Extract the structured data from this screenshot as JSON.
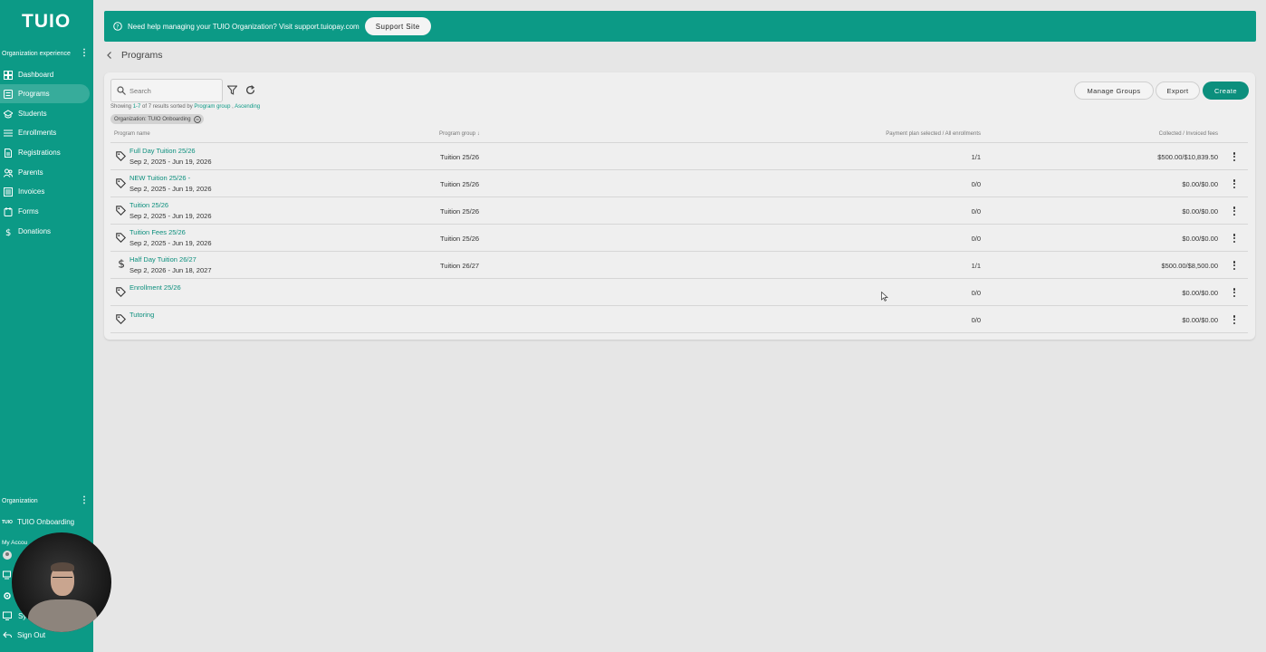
{
  "sidebar": {
    "logo": "TUIO",
    "section_experience": "Organization experience",
    "items": [
      {
        "label": "Dashboard",
        "icon": "dashboard-icon"
      },
      {
        "label": "Programs",
        "icon": "programs-icon",
        "active": true
      },
      {
        "label": "Students",
        "icon": "students-icon"
      },
      {
        "label": "Enrollments",
        "icon": "enrollments-icon"
      },
      {
        "label": "Registrations",
        "icon": "registrations-icon"
      },
      {
        "label": "Parents",
        "icon": "parents-icon"
      },
      {
        "label": "Invoices",
        "icon": "invoices-icon"
      },
      {
        "label": "Forms",
        "icon": "forms-icon"
      },
      {
        "label": "Donations",
        "icon": "dollar-icon"
      }
    ],
    "section_org": "Organization",
    "org_mini_logo": "TUIO",
    "org_name": "TUIO Onboarding",
    "section_account": "My Accou",
    "system_label": "Sy",
    "sign_out": "Sign Out"
  },
  "banner": {
    "text": "Need help managing your TUIO Organization? Visit support.tuiopay.com",
    "button": "Support Site"
  },
  "page": {
    "title": "Programs"
  },
  "toolbar": {
    "search_placeholder": "Search",
    "manage_groups": "Manage Groups",
    "export": "Export",
    "create": "Create"
  },
  "results": {
    "prefix": "Showing ",
    "range": "1-7",
    "middle": " of 7 results sorted by ",
    "sort_field": "Program group",
    "sep": " , ",
    "sort_dir": "Ascending"
  },
  "filter_chip": "Organization: TUIO Onboarding",
  "table": {
    "headers": {
      "name": "Program name",
      "group": "Program group",
      "sort_arrow": "↓",
      "plan": "Payment plan selected / All enrollments",
      "fees": "Collected / Invoiced fees"
    },
    "rows": [
      {
        "name": "Full Day Tuition 25/26",
        "dates": "Sep 2, 2025 - Jun 19, 2026",
        "group": "Tuition 25/26",
        "plan": "1/1",
        "fees": "$500.00/$10,839.50",
        "icon": "tag-icon"
      },
      {
        "name": "NEW Tuition 25/26 -",
        "dates": "Sep 2, 2025 - Jun 19, 2026",
        "group": "Tuition 25/26",
        "plan": "0/0",
        "fees": "$0.00/$0.00",
        "icon": "tag-icon"
      },
      {
        "name": "Tuition 25/26",
        "dates": "Sep 2, 2025 - Jun 19, 2026",
        "group": "Tuition 25/26",
        "plan": "0/0",
        "fees": "$0.00/$0.00",
        "icon": "tag-icon"
      },
      {
        "name": "Tuition Fees 25/26",
        "dates": "Sep 2, 2025 - Jun 19, 2026",
        "group": "Tuition 25/26",
        "plan": "0/0",
        "fees": "$0.00/$0.00",
        "icon": "tag-icon"
      },
      {
        "name": "Half Day Tuition 26/27",
        "dates": "Sep 2, 2026 - Jun 18, 2027",
        "group": "Tuition 26/27",
        "plan": "1/1",
        "fees": "$500.00/$8,500.00",
        "icon": "dollar-icon"
      },
      {
        "name": "Enrollment 25/26",
        "dates": "",
        "group": "",
        "plan": "0/0",
        "fees": "$0.00/$0.00",
        "icon": "tag-icon"
      },
      {
        "name": "Tutoring",
        "dates": "",
        "group": "",
        "plan": "0/0",
        "fees": "$0.00/$0.00",
        "icon": "tag-icon"
      }
    ]
  },
  "colors": {
    "brand": "#0c9a86",
    "link": "#0c8f7d",
    "background": "#e6e6e6"
  }
}
